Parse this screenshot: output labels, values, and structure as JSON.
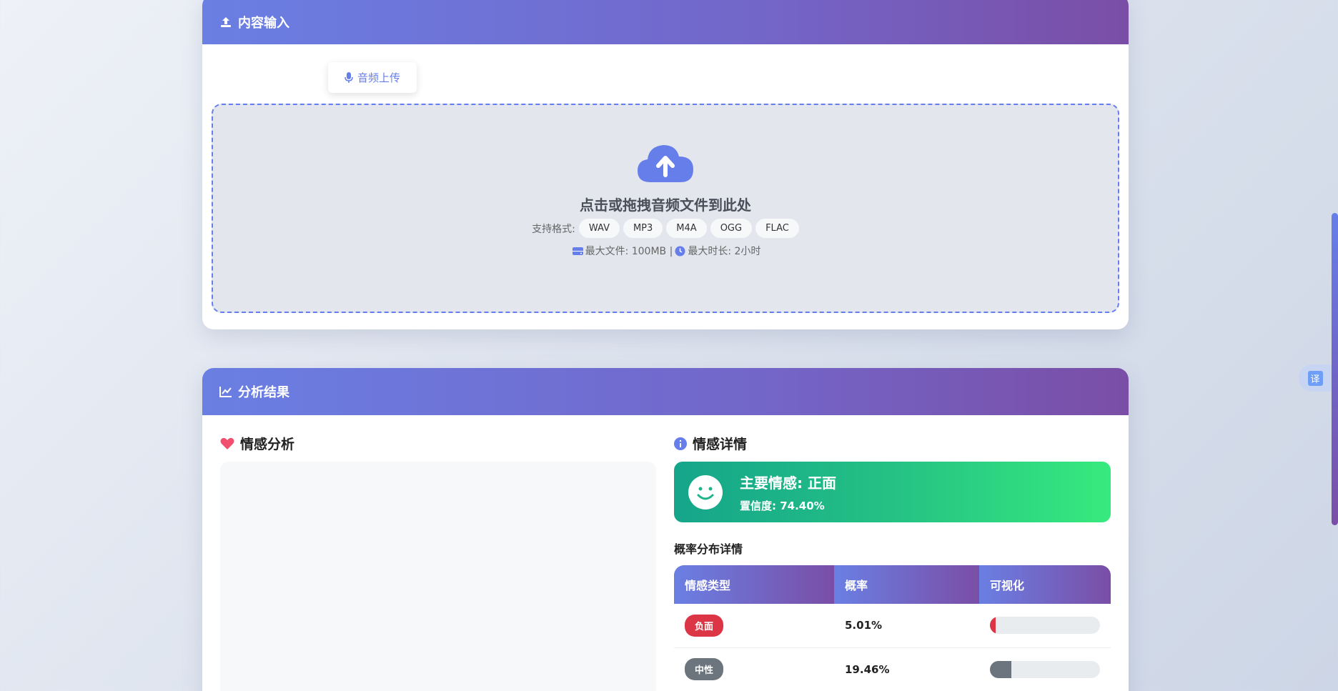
{
  "input": {
    "header": "内容输入",
    "tab_audio": "音频上传",
    "drop_title": "点击或拖拽音频文件到此处",
    "formats_label": "支持格式:",
    "formats": [
      "WAV",
      "MP3",
      "M4A",
      "OGG",
      "FLAC"
    ],
    "max_file": "最大文件: 100MB |",
    "max_duration": "最大时长: 2小时"
  },
  "results": {
    "header": "分析结果",
    "sentiment_title": "情感分析",
    "details_title": "情感详情",
    "main_emotion": "主要情感: 正面",
    "confidence": "置信度: 74.40%",
    "prob_title": "概率分布详情",
    "columns": [
      "情感类型",
      "概率",
      "可视化"
    ],
    "rows": [
      {
        "label": "负面",
        "prob": "5.01%",
        "value": 0.0501,
        "color": "#dc3545"
      },
      {
        "label": "中性",
        "prob": "19.46%",
        "value": 0.1946,
        "color": "#6c757d"
      }
    ]
  },
  "translate": {
    "label": "译"
  },
  "colors": {
    "accent": "#667eea",
    "purple": "#764ba2",
    "positive": "#22c087"
  }
}
